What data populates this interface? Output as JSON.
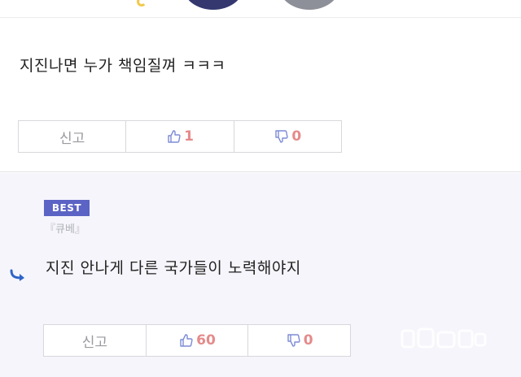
{
  "comments": [
    {
      "text": "지진나면 누가 책임질껴 ㅋㅋㅋ",
      "report_label": "신고",
      "likes": "1",
      "dislikes": "0"
    },
    {
      "badge": "BEST",
      "author": "『큐베』",
      "text": "지진 안나게 다른 국가들이 노력해야지",
      "report_label": "신고",
      "likes": "60",
      "dislikes": "0"
    }
  ],
  "colors": {
    "badge_bg": "#5b63c5",
    "count_color": "#e58a8a",
    "icon_color": "#7d8bd6",
    "reply_arrow": "#2f64c7"
  },
  "icons": [
    "thumbs-up-icon",
    "thumbs-down-icon",
    "reply-arrow-icon"
  ]
}
